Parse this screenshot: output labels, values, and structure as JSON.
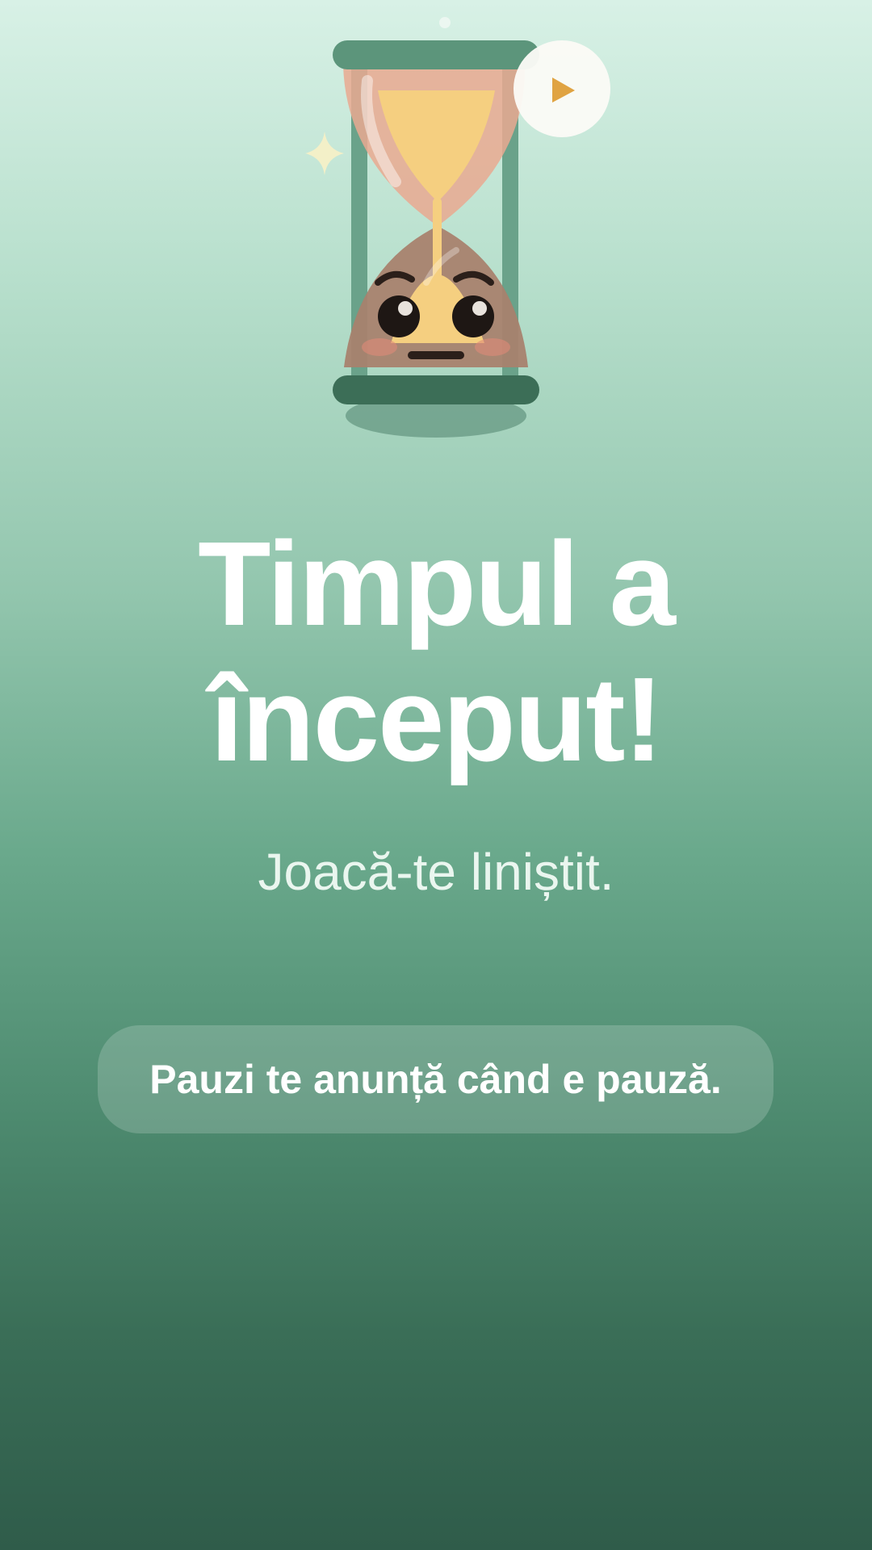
{
  "hero": {
    "title_line1": "Timpul a",
    "title_line2": "început!",
    "subtitle": "Joacă-te liniștit.",
    "notice": "Pauzi te anunță când e pauză."
  },
  "icons": {
    "mascot": "hourglass-mascot-icon",
    "play": "play-icon",
    "sparkle": "sparkle-icon"
  },
  "colors": {
    "frame": "#5f9a80",
    "sand": "#f5cf80",
    "glass": "#e9a990",
    "play_accent": "#e0a342"
  }
}
